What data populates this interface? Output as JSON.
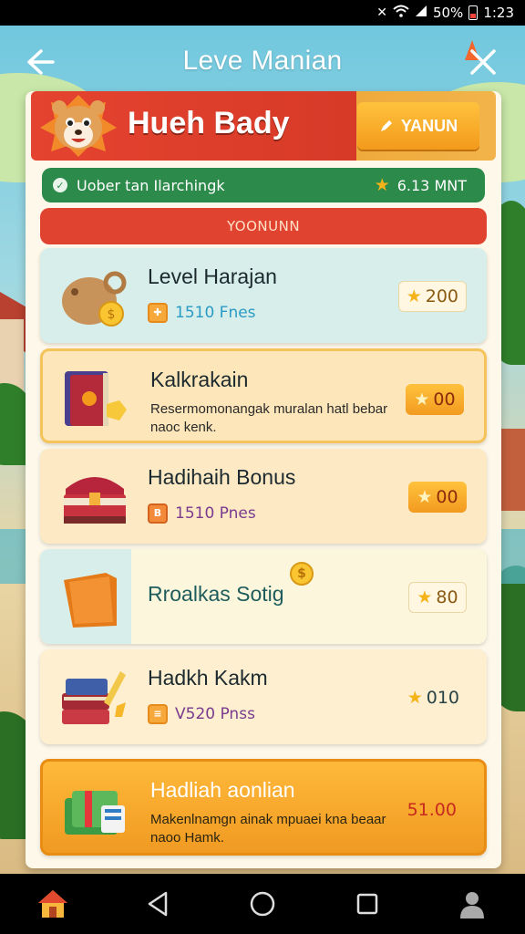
{
  "status_bar": {
    "battery": "50%",
    "time": "1:23"
  },
  "header": {
    "title": "Leve Manian"
  },
  "hero": {
    "title": "Hueh Bady",
    "button_label": "YANUN"
  },
  "info_bar": {
    "text": "Uober tan Ilarchingk",
    "value": "6.13 MNT"
  },
  "banner": {
    "label": "YOONUNN"
  },
  "items": [
    {
      "title": "Level Harajan",
      "sub": "1510 Fnes",
      "price": "200",
      "price_icon": "star-icon"
    },
    {
      "title": "Kalkrakain",
      "desc": "Resermomonangak muralan hatl bebar naoc kenk.",
      "price": "00",
      "price_icon": "star-icon"
    },
    {
      "title": "Hadihaih Bonus",
      "sub": "1510 Pnes",
      "price": "00",
      "price_icon": "star-icon"
    },
    {
      "title": "Rroalkas Sotig",
      "price": "80",
      "price_icon": "star-icon"
    },
    {
      "title": "Hadkh Kakm",
      "sub": "V520 Pnss",
      "price": "010",
      "price_icon": "star-icon"
    },
    {
      "title": "Hadliah aonlian",
      "desc": "Makenlnamgn ainak mpuaei kna beaar naoo Hamk.",
      "price": "51.00"
    }
  ],
  "colors": {
    "accent_red": "#e0432f",
    "accent_orange": "#f39a1b",
    "accent_green": "#2c8a4a",
    "panel_bg": "#fdf8e9"
  }
}
